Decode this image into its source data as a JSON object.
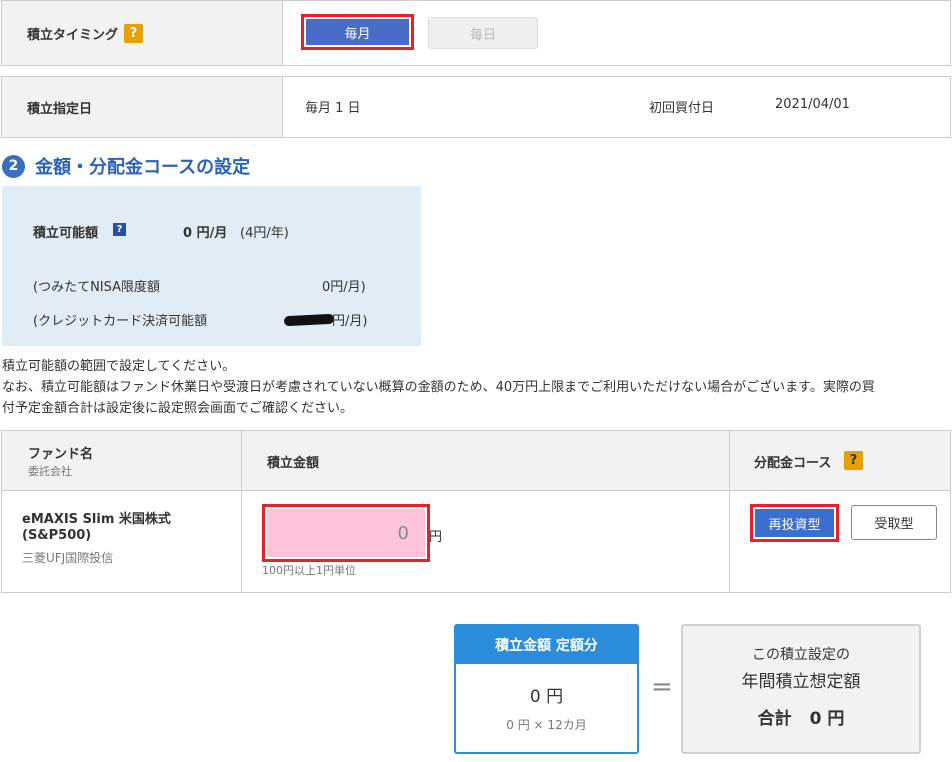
{
  "timing": {
    "label": "積立タイミング",
    "help": "?",
    "monthly_button": "毎月",
    "daily_button": "毎日"
  },
  "schedule": {
    "label": "積立指定日",
    "value": "毎月 1 日",
    "first_purchase_label": "初回買付日",
    "first_purchase_date": "2021/04/01"
  },
  "section2": {
    "number": "2",
    "title": "金額・分配金コースの設定"
  },
  "available": {
    "label": "積立可能額",
    "help": "?",
    "amount": "0 円/月",
    "per_year": "(4円/年)",
    "nisa_label": "(つみたてNISA限度額",
    "nisa_value": "0円/月)",
    "credit_label": "(クレジットカード決済可能額",
    "credit_value": "円/月)"
  },
  "notes": [
    "積立可能額の範囲で設定してください。",
    "なお、積立可能額はファンド休業日や受渡日が考慮されていない概算の金額のため、40万円上限までご利用いただけない場合がございます。実際の買",
    "付予定金額合計は設定後に設定照会画面でご確認ください。"
  ],
  "fund_table": {
    "col_fund": "ファンド名",
    "col_fund_sub": "委託会社",
    "col_amount": "積立金額",
    "col_course": "分配金コース",
    "course_help": "?",
    "fund_name_1": "eMAXIS Slim 米国株式",
    "fund_name_2": "(S&P500)",
    "company": "三菱UFJ国際投信",
    "amount_value": "0",
    "amount_unit": "円",
    "amount_hint": "100円以上1円単位",
    "reinvest_button": "再投資型",
    "receive_button": "受取型"
  },
  "summary": {
    "card_title": "積立金額 定額分",
    "card_amount": "0 円",
    "card_formula": "0 円 × 12カ月",
    "equals": "=",
    "total_line1": "この積立設定の",
    "total_line2": "年間積立想定額",
    "total_label": "合計",
    "total_amount": "0 円"
  },
  "colors": {
    "primary_blue": "#4a6cc8",
    "highlight_red": "#e8202a",
    "section_blue": "#2b63b8",
    "help_orange": "#e6a100",
    "card_blue": "#2a8ddc",
    "input_pink": "#fdc3d8"
  }
}
